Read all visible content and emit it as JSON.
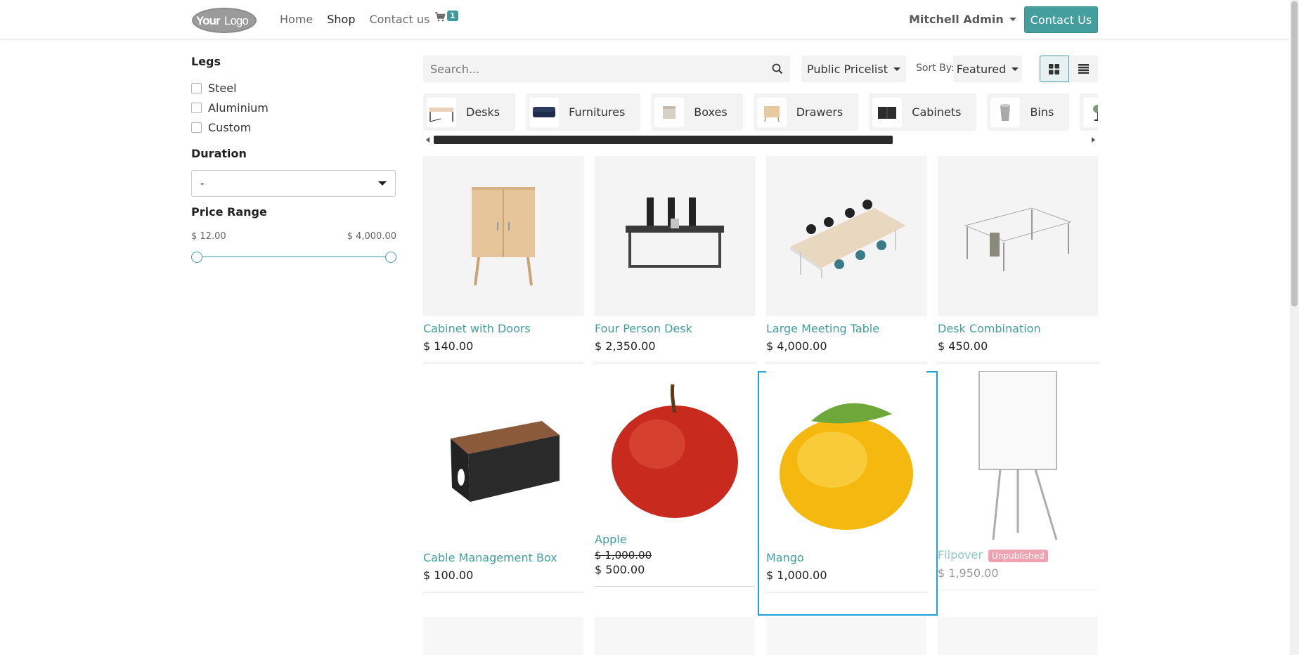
{
  "header": {
    "logo_text": "YourLogo",
    "nav": [
      "Home",
      "Shop",
      "Contact us"
    ],
    "active_nav": "Shop",
    "cart_count": "1",
    "user_name": "Mitchell Admin",
    "contact_button": "Contact Us"
  },
  "sidebar": {
    "legs_title": "Legs",
    "legs_options": [
      "Steel",
      "Aluminium",
      "Custom"
    ],
    "duration_title": "Duration",
    "duration_value": "-",
    "price_title": "Price Range",
    "price_min": "$ 12.00",
    "price_max": "$ 4,000.00"
  },
  "toolbar": {
    "search_placeholder": "Search...",
    "pricelist": "Public Pricelist",
    "sort_label": "Sort By:",
    "sort_value": "Featured"
  },
  "categories": [
    "Desks",
    "Furnitures",
    "Boxes",
    "Drawers",
    "Cabinets",
    "Bins"
  ],
  "products": [
    {
      "name": "Cabinet with Doors",
      "price": "$ 140.00"
    },
    {
      "name": "Four Person Desk",
      "price": "$ 2,350.00"
    },
    {
      "name": "Large Meeting Table",
      "price": "$ 4,000.00"
    },
    {
      "name": "Desk Combination",
      "price": "$ 450.00"
    },
    {
      "name": "Cable Management Box",
      "price": "$ 100.00"
    },
    {
      "name": "Apple",
      "old_price": "$ 1,000.00",
      "price": "$ 500.00"
    },
    {
      "name": "Mango",
      "price": "$ 1,000.00"
    },
    {
      "name": "Flipover",
      "badge": "Unpublished",
      "price": "$ 1,950.00"
    }
  ],
  "colors": {
    "accent": "#449e9e",
    "selected_border": "#1ea0d9",
    "unpublished_badge": "#e8667d"
  }
}
